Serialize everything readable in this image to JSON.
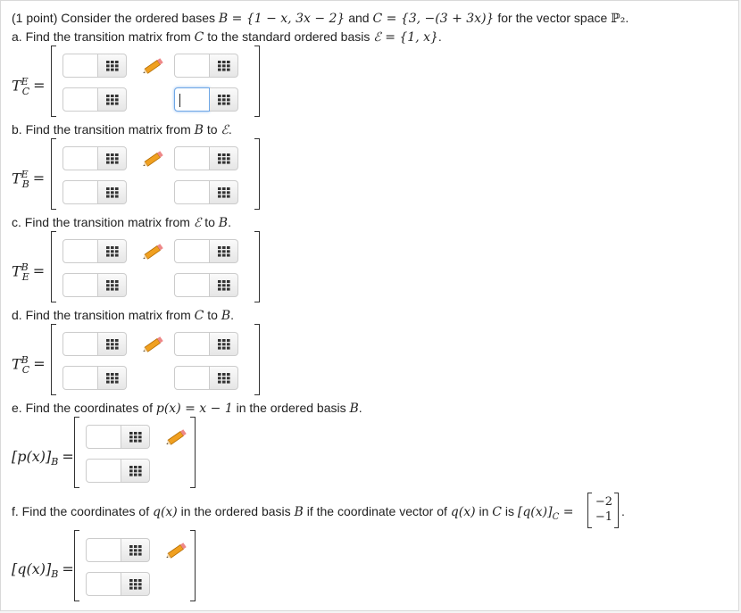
{
  "intro": {
    "points": "(1 point)",
    "text1": " Consider the ordered bases ",
    "B_def": "B = {1 − x, 3x − 2}",
    "text2": " and ",
    "C_def": "C = {3, −(3 + 3x)}",
    "text3": " for the vector space ",
    "space": "ℙ₂",
    "text4": "."
  },
  "parts": [
    {
      "label": "a. Find the transition matrix from ",
      "m1": "C",
      "mid": " to the standard ordered basis ",
      "m2": "ℰ = {1, x}",
      "end": ".",
      "lhs_base": "T",
      "lhs_sup": "E",
      "lhs_sub": "C"
    },
    {
      "label": "b. Find the transition matrix from ",
      "m1": "B",
      "mid": " to ",
      "m2": "ℰ",
      "end": ".",
      "lhs_base": "T",
      "lhs_sup": "E",
      "lhs_sub": "B"
    },
    {
      "label": "c. Find the transition matrix from ",
      "m1": "ℰ",
      "mid": " to ",
      "m2": "B",
      "end": ".",
      "lhs_base": "T",
      "lhs_sup": "B",
      "lhs_sub": "E"
    },
    {
      "label": "d. Find the transition matrix from ",
      "m1": "C",
      "mid": " to ",
      "m2": "B",
      "end": ".",
      "lhs_base": "T",
      "lhs_sup": "B",
      "lhs_sub": "C"
    }
  ],
  "part_e": {
    "label": "e. Find the coordinates of ",
    "m1": "p(x) = x − 1",
    "mid": " in the ordered basis ",
    "m2": "B",
    "end": ".",
    "lhs": "[p(x)]",
    "lhs_sub": "B"
  },
  "part_f": {
    "label": "f. Find the coordinates of ",
    "m1": "q(x)",
    "mid1": " in the ordered basis ",
    "m2": "B",
    "mid2": " if the coordinate vector of ",
    "m3": "q(x)",
    "mid3": " in ",
    "m4": "C",
    "mid4": " is ",
    "m5": "[q(x)]",
    "m5_sub": "C",
    "eq": " =",
    "vec": [
      "−2",
      "−1"
    ],
    "end": ".",
    "lhs": "[q(x)]",
    "lhs_sub": "B"
  },
  "input_values": {
    "a_r2c2": ""
  },
  "icons": {
    "palette": "matrix-palette-icon",
    "pencil": "pencil-icon"
  },
  "colors": {
    "focus": "#6fa7e6",
    "border": "#cccccc",
    "pencil_body": "#f0a020"
  }
}
